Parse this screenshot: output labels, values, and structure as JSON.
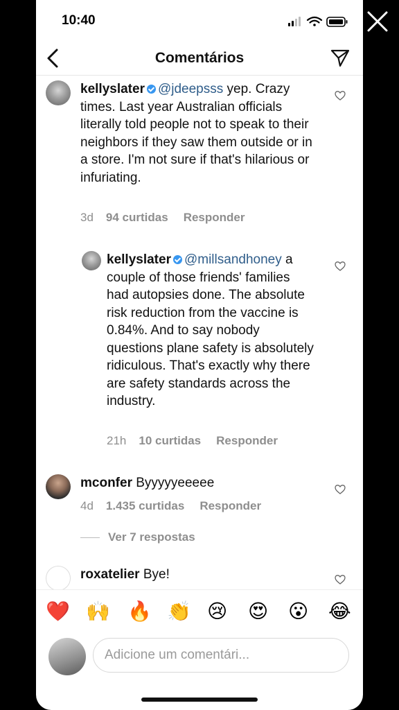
{
  "status_bar": {
    "time": "10:40"
  },
  "header": {
    "title": "Comentários"
  },
  "comments": [
    {
      "username": "kellyslater",
      "mention": "@jdeepsss",
      "text": " yep. Crazy times. Last year Australian officials literally told people not to speak to their neighbors if they saw them outside or in a store. I'm not sure if that's hilarious or infuriating.",
      "time": "3d",
      "likes": "94 curtidas",
      "reply": "Responder"
    },
    {
      "username": "kellyslater",
      "mention": "@millsandhoney",
      "text": " a couple of those friends' families had autopsies done. The absolute risk reduction from the vaccine is 0.84%. And to say nobody questions plane safety is absolutely ridiculous. That's exactly why there are safety standards across the industry.",
      "time": "21h",
      "likes": "10 curtidas",
      "reply": "Responder"
    },
    {
      "username": "mconfer",
      "text": " Byyyyyeeeee",
      "time": "4d",
      "likes": "1.435 curtidas",
      "reply": "Responder"
    },
    {
      "username": "roxatelier",
      "text": " Bye!"
    }
  ],
  "view_replies": "Ver 7 respostas",
  "emojis": [
    "❤️",
    "🙌",
    "🔥",
    "👏",
    "😢",
    "😍",
    "😮",
    "😂"
  ],
  "composer": {
    "placeholder": "Adicione um comentári..."
  },
  "icons": {
    "close": "close-icon",
    "back": "back-arrow-icon",
    "send": "direct-send-icon",
    "heart": "heart-outline-icon",
    "verified": "verified-badge-icon"
  },
  "colors": {
    "mention": "#2f5d8a",
    "verified": "#3897f0",
    "meta": "#8e8e8e"
  }
}
